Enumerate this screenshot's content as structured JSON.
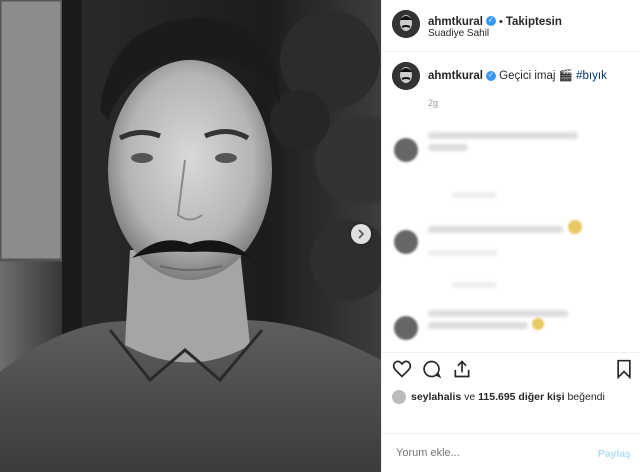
{
  "author": {
    "username": "ahmtkural",
    "follow_status": "Takiptesin",
    "location": "Suadiye Sahil",
    "verified": true
  },
  "caption": {
    "text": "Geçici imaj",
    "emoji": "🎬",
    "hashtag": "#bıyık",
    "time": "2g"
  },
  "likes": {
    "liked_by": "seylahalis",
    "connector": " ve ",
    "count": "115.695 diğer kişi",
    "suffix": " beğendi"
  },
  "comment_box": {
    "placeholder": "Yorum ekle...",
    "post_label": "Paylaş"
  },
  "icons": [
    "heart-icon",
    "comment-icon",
    "share-icon",
    "bookmark-icon",
    "verified-icon",
    "next-arrow-icon"
  ],
  "colors": {
    "verified": "#3897f0",
    "hashtag": "#003569",
    "post_disabled": "#b2dffc"
  }
}
